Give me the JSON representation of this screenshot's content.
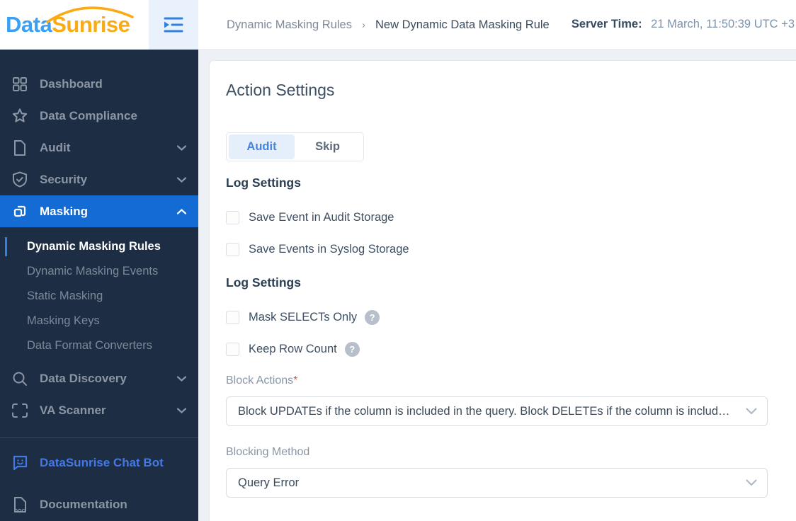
{
  "logo": {
    "part1": "Data",
    "part2": "Sunrise"
  },
  "header": {
    "breadcrumb_parent": "Dynamic Masking Rules",
    "breadcrumb_separator": "›",
    "breadcrumb_current": "New Dynamic Data Masking Rule",
    "server_time_label": "Server Time:",
    "server_time_value": "21 March, 11:50:39 UTC +3"
  },
  "sidebar": {
    "items": [
      {
        "label": "Dashboard"
      },
      {
        "label": "Data Compliance"
      },
      {
        "label": "Audit"
      },
      {
        "label": "Security"
      },
      {
        "label": "Masking"
      },
      {
        "label": "Data Discovery"
      },
      {
        "label": "VA Scanner"
      },
      {
        "label": "DataSunrise Chat Bot"
      },
      {
        "label": "Documentation"
      }
    ],
    "masking_submenu": [
      {
        "label": "Dynamic Masking Rules",
        "active": true
      },
      {
        "label": "Dynamic Masking Events",
        "active": false
      },
      {
        "label": "Static Masking",
        "active": false
      },
      {
        "label": "Masking Keys",
        "active": false
      },
      {
        "label": "Data Format Converters",
        "active": false
      }
    ]
  },
  "main": {
    "title": "Action Settings",
    "tabs": [
      {
        "label": "Audit",
        "active": true
      },
      {
        "label": "Skip",
        "active": false
      }
    ],
    "log_section_1": {
      "heading": "Log Settings",
      "checkbox_1": "Save Event in Audit Storage",
      "checkbox_2": "Save Events in Syslog Storage"
    },
    "log_section_2": {
      "heading": "Log Settings",
      "checkbox_1": "Mask SELECTs Only",
      "checkbox_2": "Keep Row Count",
      "help_glyph": "?"
    },
    "block_actions": {
      "label": "Block Actions",
      "required_mark": "*",
      "value": "Block UPDATEs if the column is included in the query. Block DELETEs if the column is includ…"
    },
    "blocking_method": {
      "label": "Blocking Method",
      "value": "Query Error"
    }
  },
  "colors": {
    "sidebar_bg": "#1d2d43",
    "active_blue": "#146bd3",
    "logo_blue": "#3ba0f3",
    "logo_orange": "#f9ab17",
    "accent_bar": "#2f80e0",
    "chatbot_blue": "#4478e4",
    "tab_active_bg": "#e5effb",
    "required_red": "#e0524e",
    "content_bg": "#edf0f4"
  }
}
